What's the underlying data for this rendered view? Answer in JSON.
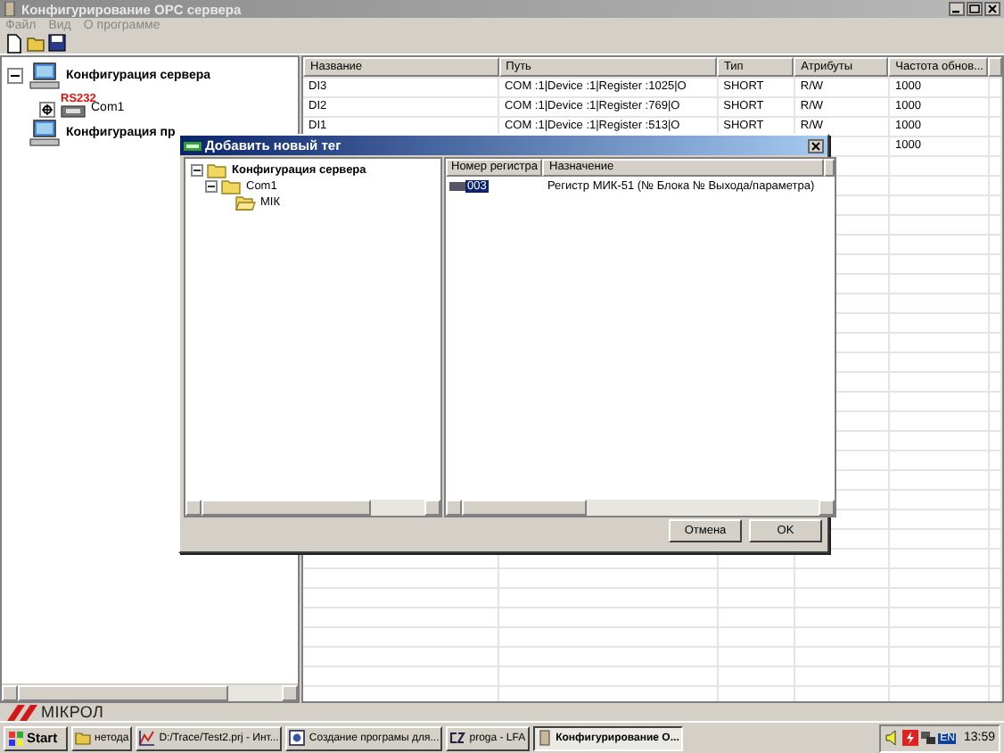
{
  "window": {
    "title": "Конфигурирование OPC сервера"
  },
  "menu": [
    "Файл",
    "Вид",
    "О программе"
  ],
  "toolbar": [
    {
      "kind": "new"
    },
    {
      "kind": "open"
    },
    {
      "kind": "save"
    }
  ],
  "server_tree": [
    {
      "label": "Конфигурация сервера",
      "expanded": true,
      "children": [
        {
          "label": "Com1",
          "badge": "RS232"
        }
      ]
    },
    {
      "label": "Конфигурация пр"
    }
  ],
  "table": {
    "columns": [
      "Название",
      "Путь",
      "Тип",
      "Атрибуты",
      "Частота обнов..."
    ],
    "rows": [
      {
        "cells": [
          "DI3",
          "COM :1|Device :1|Register :1025|O",
          "SHORT",
          "R/W",
          "1000"
        ]
      },
      {
        "cells": [
          "DI2",
          "COM :1|Device :1|Register :769|O",
          "SHORT",
          "R/W",
          "1000"
        ]
      },
      {
        "cells": [
          "DI1",
          "COM :1|Device :1|Register :513|O",
          "SHORT",
          "R/W",
          "1000"
        ]
      },
      {
        "cells": [
          null,
          null,
          null,
          null,
          "1000"
        ]
      }
    ]
  },
  "dialog": {
    "title": "Добавить новый тег",
    "tree": [
      {
        "label": "Конфигурация сервера",
        "expanded": true,
        "children": [
          {
            "label": "Com1",
            "expanded": true,
            "children": [
              {
                "label": "МІК"
              }
            ]
          }
        ]
      }
    ],
    "list": {
      "columns": [
        "Номер регистра",
        "Назначение"
      ],
      "rows": [
        {
          "cells": [
            "003",
            "Регистр МИК-51 (№ Блока № Выхода/параметра)"
          ],
          "selected": true
        }
      ]
    },
    "buttons": [
      "Отмена",
      "OK"
    ]
  },
  "logo": "МІКРОЛ",
  "taskbar": {
    "start": "Start",
    "tasks": [
      {
        "kind": "folder",
        "label": "нетода",
        "active": false
      },
      {
        "kind": "chart",
        "label": "D:/Trace/Test2.prj - Инт...",
        "active": false
      },
      {
        "kind": "doc",
        "label": "Создание програмы для...",
        "active": false
      },
      {
        "kind": "cz",
        "label": "proga - LFA",
        "active": false
      },
      {
        "kind": "app",
        "label": "Конфигурирование О...",
        "active": true
      }
    ],
    "language": "EN",
    "clock": "13:59"
  }
}
